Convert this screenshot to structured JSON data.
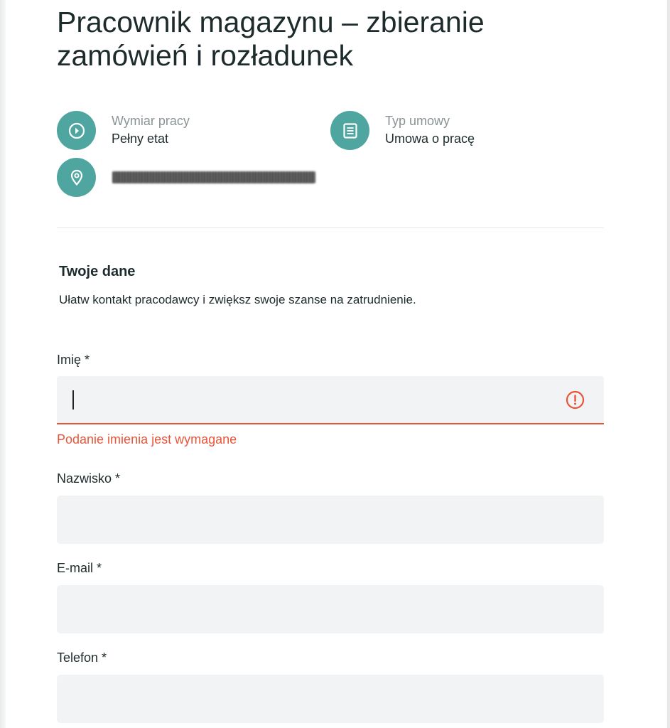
{
  "job": {
    "title": "Pracownik magazynu – zbieranie zamówień i rozładunek"
  },
  "info": {
    "work_time": {
      "icon": "clock-icon",
      "label": "Wymiar pracy",
      "value": "Pełny etat"
    },
    "contract": {
      "icon": "document-list-icon",
      "label": "Typ umowy",
      "value": "Umowa o pracę"
    },
    "location": {
      "icon": "location-pin-icon",
      "value_redacted": true
    }
  },
  "form": {
    "section_title": "Twoje dane",
    "section_description": "Ułatw kontakt pracodawcy i zwiększ swoje szanse na zatrudnienie.",
    "fields": {
      "first_name": {
        "label": "Imię *",
        "value": "",
        "error": "Podanie imienia jest wymagane",
        "error_icon": "alert-circle-icon"
      },
      "last_name": {
        "label": "Nazwisko *",
        "value": ""
      },
      "email": {
        "label": "E-mail *",
        "value": ""
      },
      "phone": {
        "label": "Telefon *",
        "value": ""
      }
    }
  },
  "colors": {
    "accent": "#4fa59f",
    "error": "#e8553a",
    "input_bg": "#f2f3f4",
    "text": "#1e2b2c",
    "muted": "#8a9495"
  }
}
